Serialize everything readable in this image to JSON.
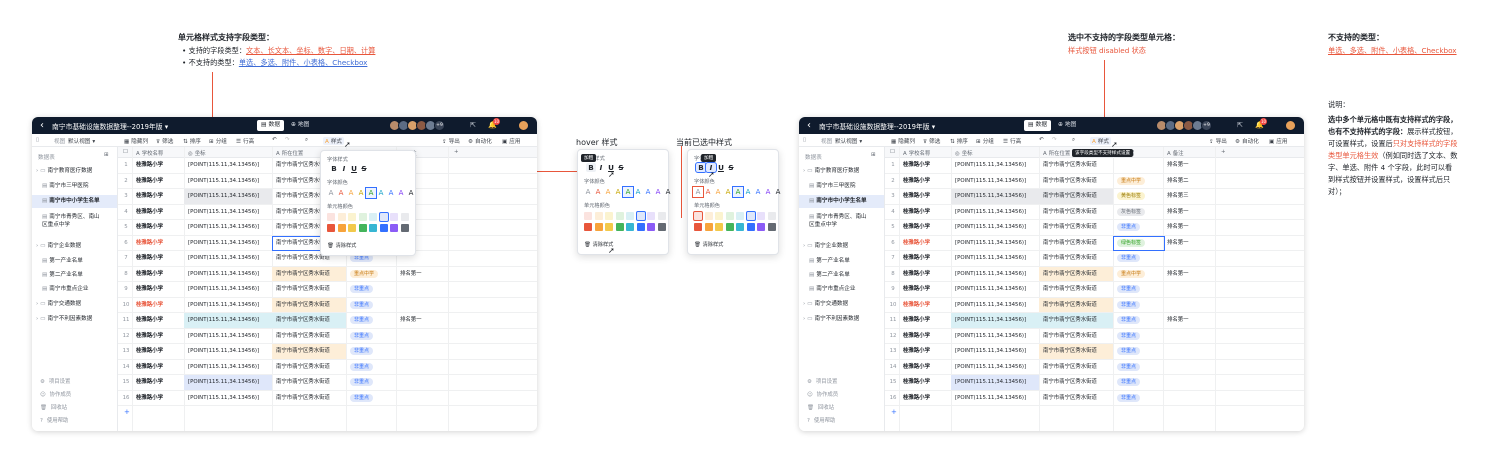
{
  "annotations": {
    "left_title": "单元格样式支持字段类型：",
    "left_supported_prefix": "• 支持的字段类型：",
    "left_supported_types": "文本、长文本、坐标、数字、日期、计算",
    "left_unsupported_prefix": "• 不支持的类型：",
    "left_unsupported_types": "单选、多选、附件、小表格、Checkbox",
    "hover_title": "hover 样式",
    "selected_title": "当前已选中样式",
    "mixed_title": "选中不支持的字段类型单元格：",
    "mixed_sub": "样式按钮 disabled 状态",
    "unsup_title": "不支持的类型：",
    "unsup_types": "单选、多选、附件、小表格、Checkbox",
    "desc_title": "说明：",
    "desc_bold_1": "选中多个单元格中既有支持样式的字段，",
    "desc_bold_2": "也有不支持样式的字段：",
    "desc_1": "展示样式按钮，",
    "desc_2": "可设置样式，设置后",
    "desc_red_1": "只对支持样式的字段",
    "desc_red_2": "类型单元格生效",
    "desc_3": "（例如同时选了文本、数",
    "desc_4": "字、单选、附件 4 个字段，此时可以看",
    "desc_5": "到样式按钮并设置样式，设置样式后只",
    "desc_6": "对）；"
  },
  "app": {
    "title": "南宁市基础设施数据整理--2019年版 ▾",
    "tab_data": "数据",
    "tab_map": "地图",
    "avatar_more": "+9",
    "notif_count": "10",
    "view_name": "视图",
    "view_value": "默认视图",
    "toolbar": {
      "hide": "隐藏列",
      "filter": "筛选",
      "sort": "排序",
      "group": "分组",
      "rowheight": "行高",
      "style": "样式",
      "export": "导出",
      "auto": "自动化",
      "apply": "应用"
    },
    "sidebar": {
      "head": "数据表",
      "items": [
        "南宁教育医疗数据",
        "南宁市三甲医院",
        "南宁市中小学生名单",
        "南宁市青秀区、南山区重点中学",
        "南宁企业数据",
        "第一产业名单",
        "第二产业名单",
        "南宁市重点企业",
        "南宁交通数据",
        "南宁不利因素数据"
      ],
      "foot": [
        "项目设置",
        "协作成员",
        "回收站",
        "使用帮助"
      ]
    },
    "headers": [
      "学校名称",
      "坐标",
      "所在位置",
      "所属",
      "备注"
    ],
    "rows": [
      {
        "n": "1",
        "name": "桂雅路小学",
        "coord": "[POINT(115.11,34.13456)]",
        "loc": "南宁市翡宁区秀水街道",
        "tag": "",
        "tag2": "",
        "note": "",
        "note2": "排名第一"
      },
      {
        "n": "2",
        "name": "桂雅路小学",
        "coord": "[POINT(115.11,34.13456)]",
        "loc": "南宁市翡宁区秀水街道",
        "tag": "",
        "tag2": "重点中学",
        "note": "",
        "note2": "排名第二"
      },
      {
        "n": "3",
        "name": "桂雅路小学",
        "coord": "[POINT(115.11,34.13456)]",
        "loc": "南宁市翡宁区秀水街道",
        "tag": "",
        "tag2": "黄色标签",
        "note": "",
        "note2": "排名第三"
      },
      {
        "n": "4",
        "name": "桂雅路小学",
        "coord": "[POINT(115.11,34.13456)]",
        "loc": "南宁市翡宁区秀水街道",
        "tag": "",
        "tag2": "灰色标签",
        "note": "",
        "note2": "排名第一"
      },
      {
        "n": "5",
        "name": "桂雅路小学",
        "coord": "[POINT(115.11,34.13456)]",
        "loc": "南宁市翡宁区秀水街道",
        "tag": "",
        "tag2": "非重点",
        "note": "",
        "note2": "排名第一"
      },
      {
        "n": "6",
        "name": "桂雅路小学",
        "coord": "[POINT(115.11,34.13456)]",
        "loc": "南宁市翡宁区秀水街道",
        "tag": "",
        "tag2": "绿色标签",
        "note": "",
        "note2": "排名第一"
      },
      {
        "n": "7",
        "name": "桂雅路小学",
        "coord": "[POINT(115.11,34.13456)]",
        "loc": "南宁市翡宁区秀水街道",
        "tag": "非重点",
        "tag2": "非重点",
        "note": "",
        "note2": ""
      },
      {
        "n": "8",
        "name": "桂雅路小学",
        "coord": "[POINT(115.11,34.13456)]",
        "loc": "南宁市翡宁区秀水街道",
        "tag": "重点中学",
        "tag2": "重点中学",
        "note": "排名第一",
        "note2": "排名第一"
      },
      {
        "n": "9",
        "name": "桂雅路小学",
        "coord": "[POINT(115.11,34.13456)]",
        "loc": "南宁市翡宁区秀水街道",
        "tag": "非重点",
        "tag2": "非重点",
        "note": "",
        "note2": ""
      },
      {
        "n": "10",
        "name": "桂雅路小学",
        "coord": "[POINT(115.11,34.13456)]",
        "loc": "南宁市翡宁区秀水街道",
        "tag": "非重点",
        "tag2": "非重点",
        "note": "",
        "note2": ""
      },
      {
        "n": "11",
        "name": "桂雅路小学",
        "coord": "[POINT(115.11,34.13456)]",
        "loc": "南宁市翡宁区秀水街道",
        "tag": "非重点",
        "tag2": "非重点",
        "note": "排名第一",
        "note2": "排名第一"
      },
      {
        "n": "12",
        "name": "桂雅路小学",
        "coord": "[POINT(115.11,34.13456)]",
        "loc": "南宁市翡宁区秀水街道",
        "tag": "非重点",
        "tag2": "非重点",
        "note": "",
        "note2": ""
      },
      {
        "n": "13",
        "name": "桂雅路小学",
        "coord": "[POINT(115.11,34.13456)]",
        "loc": "南宁市翡宁区秀水街道",
        "tag": "非重点",
        "tag2": "非重点",
        "note": "",
        "note2": ""
      },
      {
        "n": "14",
        "name": "桂雅路小学",
        "coord": "[POINT(115.11,34.13456)]",
        "loc": "南宁市翡宁区秀水街道",
        "tag": "非重点",
        "tag2": "非重点",
        "note": "",
        "note2": ""
      },
      {
        "n": "15",
        "name": "桂雅路小学",
        "coord": "[POINT(115.11,34.13456)]",
        "loc": "南宁市翡宁区秀水街道",
        "tag": "非重点",
        "tag2": "非重点",
        "note": "",
        "note2": ""
      },
      {
        "n": "16",
        "name": "桂雅路小学",
        "coord": "[POINT(115.11,34.13456)]",
        "loc": "南宁市翡宁区秀水街道",
        "tag": "非重点",
        "tag2": "非重点",
        "note": "",
        "note2": ""
      }
    ],
    "add_row": "+"
  },
  "popover": {
    "font_style": "字体样式",
    "bold": "B",
    "italic": "I",
    "underline": "U",
    "strike": "S",
    "font_color": "字体颜色",
    "cell_color": "单元格颜色",
    "clear": "清除样式",
    "letter": "A",
    "tip_bold": "加粗",
    "tip_disabled": "该字段类型不支持样式设置"
  },
  "colors": {
    "font": [
      "#8f959e",
      "#e8563b",
      "#f7a33b",
      "#c7a500",
      "#2ea121",
      "#14a1c7",
      "#3370ff",
      "#7f3bf5",
      "#1f2329"
    ],
    "cell": [
      "#fbe3df",
      "#fdeed8",
      "#fbf3cf",
      "#dff2de",
      "#d9f0f5",
      "#dfe7fa",
      "#e8e0fb",
      "#e9eaed",
      "#e8563b",
      "#f7a33b",
      "#f2c94c",
      "#43b45b",
      "#37b6d3",
      "#3370ff",
      "#8b5cf6",
      "#646a73"
    ]
  }
}
